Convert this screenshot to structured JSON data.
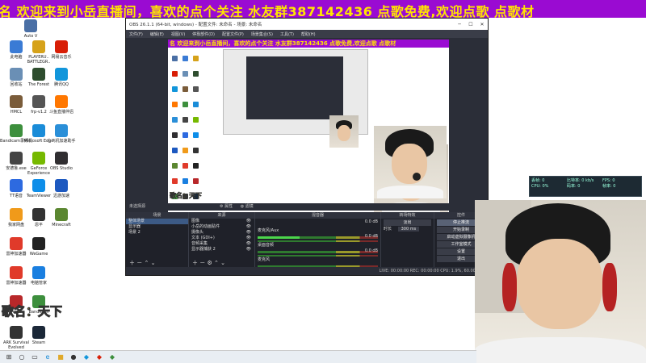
{
  "marquee": {
    "text": "名   欢迎来到小岳直播间，喜欢的点个关注  水友群387142436    点歌免费,欢迎点歌  点歌材"
  },
  "desktop": {
    "icons": [
      {
        "label": "Auto V",
        "color": "#4a6fa5"
      },
      {
        "label": "此电脑",
        "color": "#3a7bd5"
      },
      {
        "label": "PLAYERU.. BATTLEGR..",
        "color": "#d6a21a"
      },
      {
        "label": "网易云音乐",
        "color": "#d81e06"
      },
      {
        "label": "回收站",
        "color": "#6a8fb5"
      },
      {
        "label": "The Forest",
        "color": "#2e4d2e"
      },
      {
        "label": "腾讯QQ",
        "color": "#1296db"
      },
      {
        "label": "HMCL",
        "color": "#7a5c3a"
      },
      {
        "label": "frp-v1.2",
        "color": "#555555"
      },
      {
        "label": "斗鱼直播伴侣",
        "color": "#ff7700"
      },
      {
        "label": "Bandicam录频机",
        "color": "#3d8f3d"
      },
      {
        "label": "Microsoft Edge",
        "color": "#1a8cd8"
      },
      {
        "label": "小飞机加速助手",
        "color": "#2a8fd8"
      },
      {
        "label": "安德鲁.exe",
        "color": "#444444"
      },
      {
        "label": "GeForce Experience",
        "color": "#76b900"
      },
      {
        "label": "OBS Studio",
        "color": "#302e31"
      },
      {
        "label": "TT语音",
        "color": "#2d6ae0"
      },
      {
        "label": "TeamViewer",
        "color": "#0e8ee9"
      },
      {
        "label": "迅游加速",
        "color": "#1d59c0"
      },
      {
        "label": "我家网盘",
        "color": "#f09a1a"
      },
      {
        "label": "恩平",
        "color": "#333333"
      },
      {
        "label": "Minecraft",
        "color": "#5b8731"
      },
      {
        "label": "雷神加速器",
        "color": "#e03a2a"
      },
      {
        "label": "WeGame",
        "color": "#222222"
      },
      {
        "label": "雷神加速器",
        "color": "#e03a2a"
      },
      {
        "label": "电脑管家",
        "color": "#1a7fe0"
      },
      {
        "label": "Apex",
        "color": "#b8282a"
      },
      {
        "label": "Bandicam",
        "color": "#3d8f3d"
      },
      {
        "label": "ARK Survival Evolved",
        "color": "#333333"
      },
      {
        "label": "Steam",
        "color": "#1b2838"
      }
    ],
    "song_label": "歌名：天下"
  },
  "obs": {
    "title": "OBS 26.1.1 (64-bit, windows) - 配置文件: 未命名 - 场景: 未命名",
    "menu": [
      "文件(F)",
      "编辑(E)",
      "视图(V)",
      "停靠部件(D)",
      "配置文件(P)",
      "场景集合(S)",
      "工具(T)",
      "帮助(H)"
    ],
    "preview_marquee": "名   欢迎来到小岳直播间，喜欢的点个关注  水友群387142436    点歌免费,欢迎点歌  点歌材",
    "song_mini": "歌名：天下",
    "source_bar": [
      "未选择源",
      "属性",
      "滤镜"
    ],
    "docks": {
      "scenes": {
        "header": "场景",
        "items": [
          "整体场景",
          "显示器",
          "场景 2"
        ],
        "selected": 0
      },
      "sources": {
        "header": "来源",
        "items": [
          "图像",
          "小岳的动画贴件",
          "摄像头",
          "文本 (GDI+)",
          "音频采集",
          "显示器捕获 2"
        ]
      },
      "mixer": {
        "header": "混音器",
        "channels": [
          {
            "name": "麦克风/Aux",
            "db": "0.0 dB"
          },
          {
            "name": "桌面音频",
            "db": "0.0 dB"
          },
          {
            "name": "麦克风",
            "db": "0.0 dB"
          }
        ]
      },
      "transitions": {
        "header": "转场特效",
        "type": "淡出",
        "duration_label": "时长",
        "duration": "300 ms"
      },
      "controls": {
        "header": "控件",
        "buttons": [
          "停止推流",
          "开始录制",
          "启动虚拟摄像机",
          "工作室模式",
          "设置",
          "退出"
        ]
      }
    },
    "status": "LIVE: 00:00:00    REC: 00:00:00    CPU: 1.9%, 60.00 fps"
  },
  "stats": {
    "lines": [
      "丢帧: 0",
      "比特率: 0 kb/s",
      "FPS: 0",
      "CPU: 0%",
      "码率: 0",
      "帧率: 0"
    ]
  }
}
